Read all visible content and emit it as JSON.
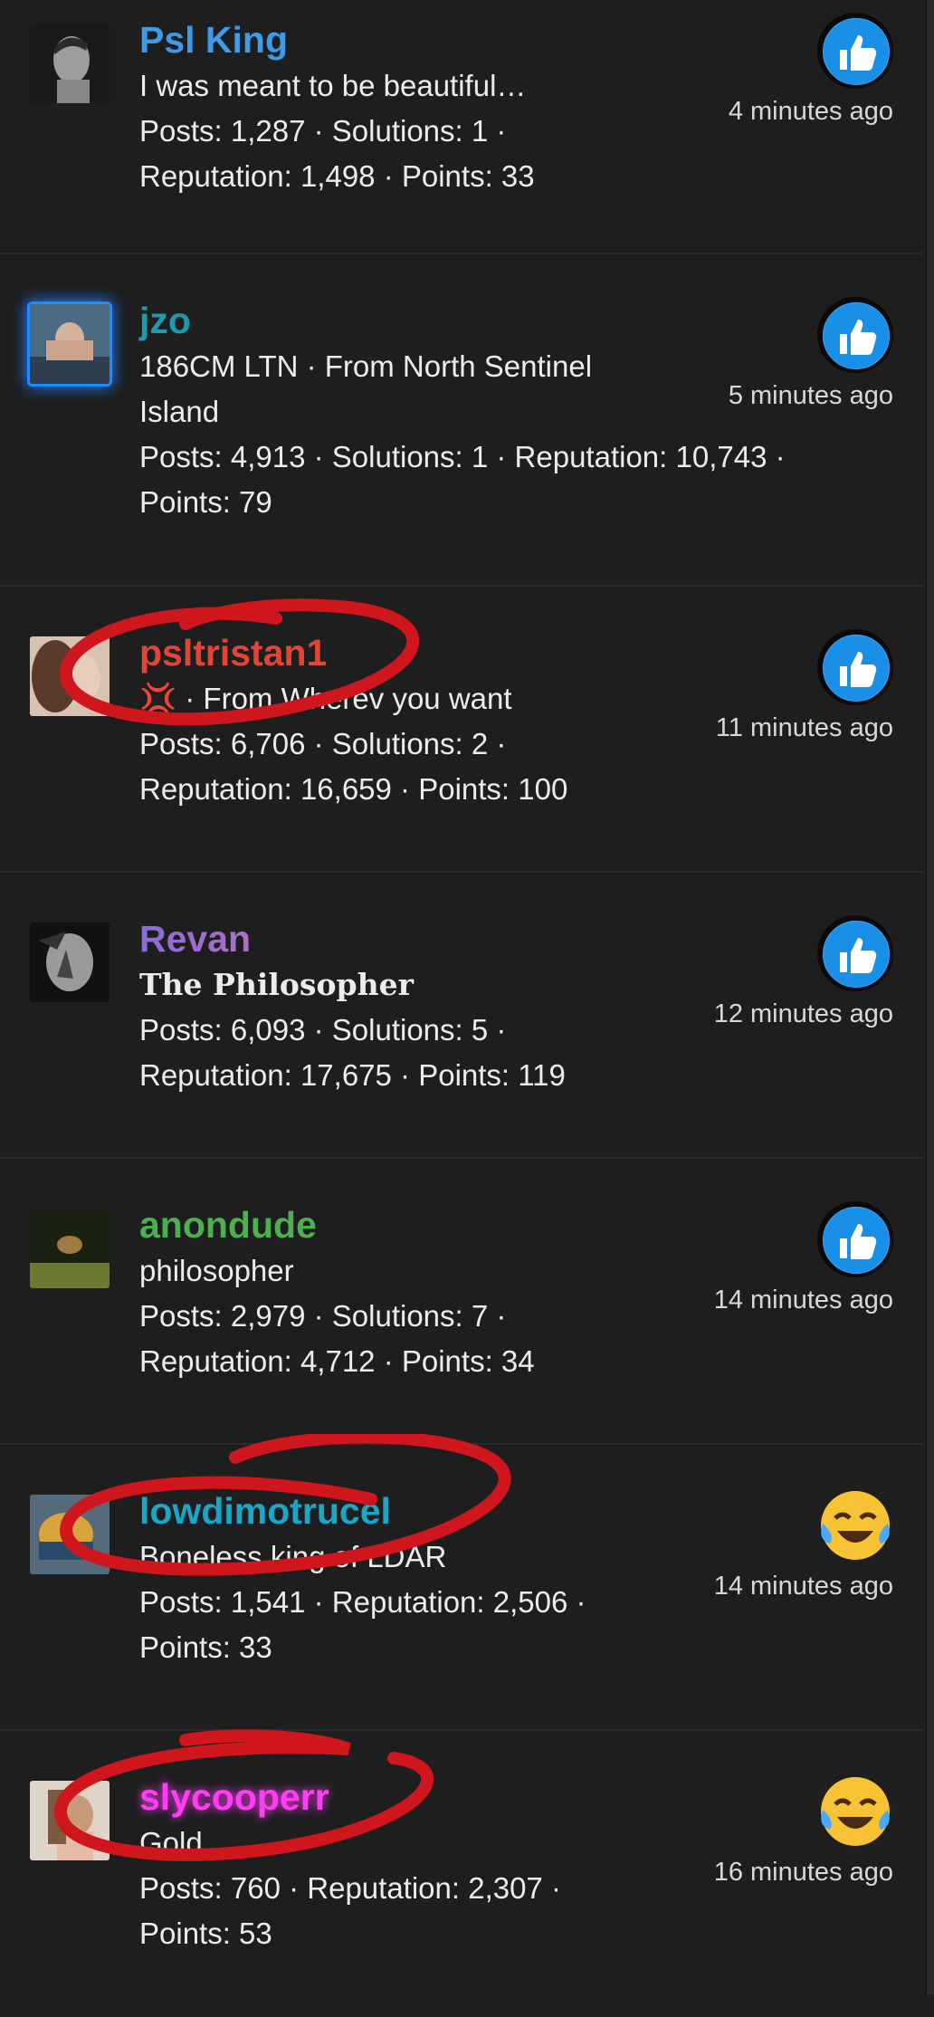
{
  "posts": [
    {
      "username": "Psl King",
      "name_color": "#3d9be9",
      "subtitle": "I was meant to be beautiful…",
      "stats_line1": "Posts: 1,287 · Solutions: 1 ·",
      "stats_line2": "Reputation: 1,498 · Points: 33",
      "reaction": "thumbs-up",
      "time": "4 minutes ago"
    },
    {
      "username": "jzo",
      "name_color": "#1c9ab0",
      "subtitle": "186CM LTN · From North Sentinel",
      "subtitle2": "Island",
      "stats_line1": "Posts: 4,913 · Solutions: 1 · Reputation: 10,743 ·",
      "stats_line2": "Points: 79",
      "reaction": "thumbs-up",
      "time": "5 minutes ago"
    },
    {
      "username": "psltristan1",
      "name_color": "#e04536",
      "subtitle": "· From Wherev    you want",
      "stats_line1": "Posts: 6,706 · Solutions: 2 ·",
      "stats_line2": "Reputation: 16,659 · Points: 100",
      "reaction": "thumbs-up",
      "time": "11 minutes ago"
    },
    {
      "username": "Revan",
      "name_color": "#b07ad8",
      "subtitle": "The Philosopher",
      "stats_line1": "Posts: 6,093 · Solutions: 5 ·",
      "stats_line2": "Reputation: 17,675 · Points: 119",
      "reaction": "thumbs-up",
      "time": "12 minutes ago"
    },
    {
      "username": "anondude",
      "name_color": "#4caf50",
      "subtitle": "philosopher",
      "stats_line1": "Posts: 2,979 · Solutions: 7 ·",
      "stats_line2": "Reputation: 4,712 · Points: 34",
      "reaction": "thumbs-up",
      "time": "14 minutes ago"
    },
    {
      "username": "lowdimotrucel",
      "name_color": "#1aa7c7",
      "subtitle": "Boneless king of LDAR",
      "stats_line1": "Posts: 1,541 · Reputation: 2,506 ·",
      "stats_line2": "Points: 33",
      "reaction": "laugh-cry",
      "time": "14 minutes ago"
    },
    {
      "username": "slycooperr",
      "name_color": "#ff3df5",
      "subtitle": "Gold",
      "stats_line1": "Posts: 760 · Reputation: 2,307 ·",
      "stats_line2": "Points: 53",
      "reaction": "laugh-cry",
      "time": "16 minutes ago"
    }
  ]
}
